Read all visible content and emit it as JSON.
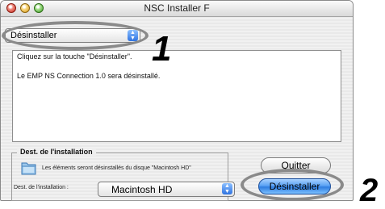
{
  "window": {
    "title": "NSC Installer F"
  },
  "action_popup": {
    "selected": "Désinstaller",
    "arrows": "▲▼"
  },
  "annotations": {
    "step1": "1",
    "step2": "2"
  },
  "message": {
    "line1": "Cliquez sur la touche \"Désinstaller\".",
    "line2": "Le EMP NS Connection 1.0 sera désinstallé."
  },
  "destination": {
    "group_label": "Dest. de l'installation",
    "info": "Les éléments seront désinstallés du disque \"Macintosh HD\"",
    "field_label": "Dest. de l'installation :",
    "disk": "Macintosh HD"
  },
  "buttons": {
    "quit": "Quitter",
    "uninstall": "Désinstaller"
  },
  "colors": {
    "default_button": "#2e7de0",
    "annotation_ring": "#8a8a8a"
  },
  "icons": {
    "folder": "folder-icon",
    "close": "close-icon",
    "minimize": "minimize-icon",
    "zoom": "zoom-icon"
  }
}
